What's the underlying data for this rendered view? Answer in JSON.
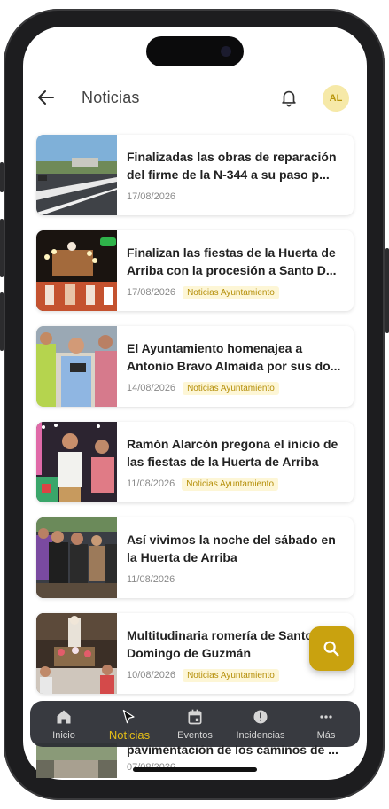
{
  "header": {
    "title": "Noticias",
    "avatar_initials": "AL",
    "back_icon": "arrow-left-icon",
    "notification_icon": "bell-icon"
  },
  "news": [
    {
      "title": "Finalizadas las obras de reparación del firme de la N-344 a su paso p...",
      "date": "17/08/2026",
      "tag": ""
    },
    {
      "title": "Finalizan las fiestas de la Huerta de Arriba con la procesión a Santo D...",
      "date": "17/08/2026",
      "tag": "Noticias Ayuntamiento"
    },
    {
      "title": "El Ayuntamiento homenajea a Antonio Bravo Almaida por sus do...",
      "date": "14/08/2026",
      "tag": "Noticias Ayuntamiento"
    },
    {
      "title": "Ramón Alarcón pregona el inicio de las fiestas de la Huerta de Arriba",
      "date": "11/08/2026",
      "tag": "Noticias Ayuntamiento"
    },
    {
      "title": "Así vivimos la noche del sábado en la Huerta de Arriba",
      "date": "11/08/2026",
      "tag": ""
    },
    {
      "title": "Multitudinaria romería de Santo Domingo de Guzmán",
      "date": "10/08/2026",
      "tag": "Noticias Ayuntamiento"
    }
  ],
  "partial_item": {
    "title": "pavimentación de los caminos de ...",
    "date": "07/08/2026"
  },
  "fab": {
    "icon": "search-icon"
  },
  "nav": [
    {
      "label": "Inicio",
      "icon": "home-icon"
    },
    {
      "label": "Noticias",
      "icon": "newspaper-icon"
    },
    {
      "label": "Eventos",
      "icon": "calendar-icon"
    },
    {
      "label": "Incidencias",
      "icon": "alert-icon"
    },
    {
      "label": "Más",
      "icon": "more-icon"
    }
  ],
  "colors": {
    "accent": "#c9a20f",
    "nav_bg": "#2c2e34",
    "tag_text": "#b58f0a",
    "tag_bg": "#fdf6d6"
  }
}
